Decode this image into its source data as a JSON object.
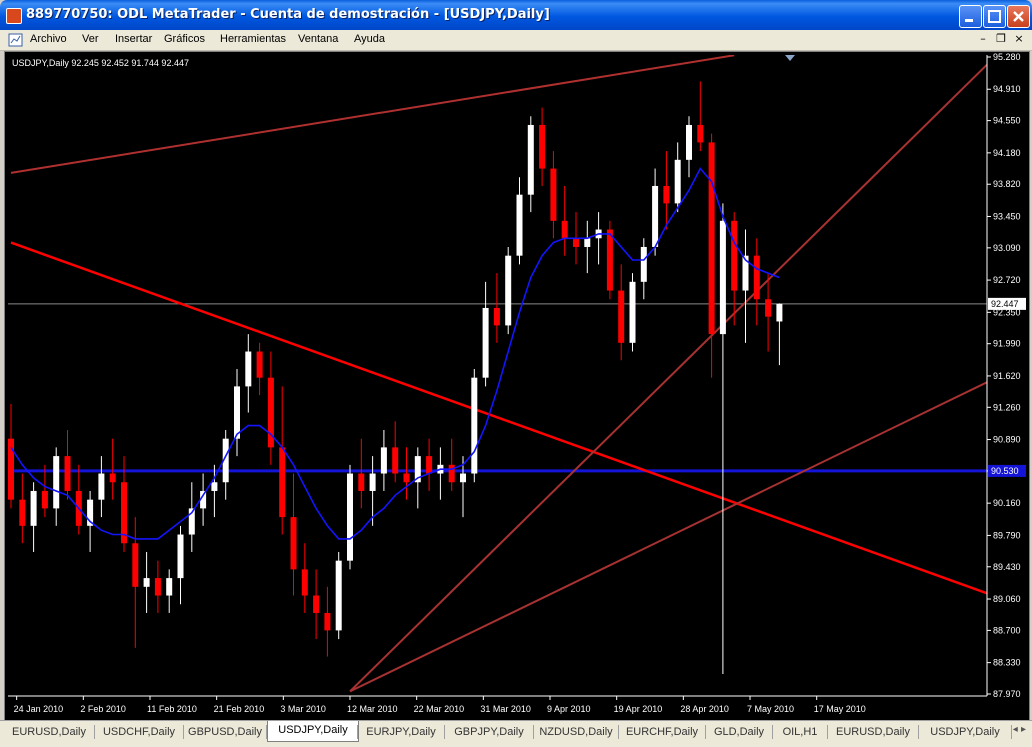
{
  "window": {
    "title": "889770750: ODL MetaTrader - Cuenta de demostración - [USDJPY,Daily]"
  },
  "menu": {
    "items": [
      "Archivo",
      "Ver",
      "Insertar",
      "Gráficos",
      "Herramientas",
      "Ventana",
      "Ayuda"
    ]
  },
  "chart_data": {
    "type": "candlestick",
    "title": "USDJPY,Daily  92.245 92.452 91.744 92.447",
    "last_price_label": "92.447",
    "horizontal_line_label": "90.530",
    "ylim": [
      87.97,
      95.28
    ],
    "y_ticks": [
      "95.280",
      "94.910",
      "94.550",
      "94.180",
      "93.820",
      "93.450",
      "93.090",
      "92.720",
      "92.350",
      "91.990",
      "91.620",
      "91.260",
      "90.890",
      "90.530",
      "90.160",
      "89.790",
      "89.430",
      "89.060",
      "88.700",
      "88.330",
      "87.970"
    ],
    "x_ticks": [
      "24 Jan 2010",
      "2 Feb 2010",
      "11 Feb 2010",
      "21 Feb 2010",
      "3 Mar 2010",
      "12 Mar 2010",
      "22 Mar 2010",
      "31 Mar 2010",
      "9 Apr 2010",
      "19 Apr 2010",
      "28 Apr 2010",
      "7 May 2010",
      "17 May 2010"
    ],
    "candles": [
      [
        90.9,
        91.3,
        90.1,
        90.2
      ],
      [
        90.2,
        90.5,
        89.7,
        89.9
      ],
      [
        89.9,
        90.4,
        89.6,
        90.3
      ],
      [
        90.3,
        90.6,
        90.0,
        90.1
      ],
      [
        90.1,
        90.8,
        89.9,
        90.7
      ],
      [
        90.7,
        91.0,
        90.2,
        90.3
      ],
      [
        90.3,
        90.6,
        89.8,
        89.9
      ],
      [
        89.9,
        90.3,
        89.6,
        90.2
      ],
      [
        90.2,
        90.7,
        90.0,
        90.5
      ],
      [
        90.5,
        90.9,
        90.2,
        90.4
      ],
      [
        90.4,
        90.7,
        89.6,
        89.7
      ],
      [
        89.7,
        90.0,
        88.5,
        89.2
      ],
      [
        89.2,
        89.6,
        88.9,
        89.3
      ],
      [
        89.3,
        89.5,
        88.9,
        89.1
      ],
      [
        89.1,
        89.4,
        88.9,
        89.3
      ],
      [
        89.3,
        89.9,
        89.0,
        89.8
      ],
      [
        89.8,
        90.4,
        89.6,
        90.1
      ],
      [
        90.1,
        90.5,
        89.9,
        90.3
      ],
      [
        90.3,
        90.6,
        90.0,
        90.4
      ],
      [
        90.4,
        91.0,
        90.2,
        90.9
      ],
      [
        90.9,
        91.7,
        90.7,
        91.5
      ],
      [
        91.5,
        92.1,
        91.2,
        91.9
      ],
      [
        91.9,
        92.0,
        91.4,
        91.6
      ],
      [
        91.6,
        91.9,
        90.6,
        90.8
      ],
      [
        90.8,
        91.5,
        89.8,
        90.0
      ],
      [
        90.0,
        90.5,
        89.1,
        89.4
      ],
      [
        89.4,
        89.7,
        88.9,
        89.1
      ],
      [
        89.1,
        89.4,
        88.6,
        88.9
      ],
      [
        88.9,
        89.2,
        88.4,
        88.7
      ],
      [
        88.7,
        89.6,
        88.6,
        89.5
      ],
      [
        89.5,
        90.6,
        89.4,
        90.5
      ],
      [
        90.5,
        90.9,
        90.1,
        90.3
      ],
      [
        90.3,
        90.7,
        89.9,
        90.5
      ],
      [
        90.5,
        91.0,
        90.3,
        90.8
      ],
      [
        90.8,
        91.1,
        90.4,
        90.5
      ],
      [
        90.5,
        90.8,
        90.2,
        90.4
      ],
      [
        90.4,
        90.8,
        90.1,
        90.7
      ],
      [
        90.7,
        90.9,
        90.3,
        90.5
      ],
      [
        90.5,
        90.8,
        90.2,
        90.6
      ],
      [
        90.6,
        90.9,
        90.3,
        90.4
      ],
      [
        90.4,
        90.7,
        90.0,
        90.5
      ],
      [
        90.5,
        91.7,
        90.4,
        91.6
      ],
      [
        91.6,
        92.7,
        91.5,
        92.4
      ],
      [
        92.4,
        92.8,
        92.0,
        92.2
      ],
      [
        92.2,
        93.1,
        92.1,
        93.0
      ],
      [
        93.0,
        93.9,
        92.9,
        93.7
      ],
      [
        93.7,
        94.6,
        93.5,
        94.5
      ],
      [
        94.5,
        94.7,
        93.8,
        94.0
      ],
      [
        94.0,
        94.2,
        93.2,
        93.4
      ],
      [
        93.4,
        93.8,
        93.0,
        93.2
      ],
      [
        93.2,
        93.5,
        92.9,
        93.1
      ],
      [
        93.1,
        93.4,
        92.8,
        93.2
      ],
      [
        93.2,
        93.5,
        92.9,
        93.3
      ],
      [
        93.3,
        93.4,
        92.5,
        92.6
      ],
      [
        92.6,
        92.9,
        91.8,
        92.0
      ],
      [
        92.0,
        92.8,
        91.9,
        92.7
      ],
      [
        92.7,
        93.2,
        92.5,
        93.1
      ],
      [
        93.1,
        94.0,
        93.0,
        93.8
      ],
      [
        93.8,
        94.2,
        93.3,
        93.6
      ],
      [
        93.6,
        94.3,
        93.5,
        94.1
      ],
      [
        94.1,
        94.6,
        93.9,
        94.5
      ],
      [
        94.5,
        95.0,
        94.2,
        94.3
      ],
      [
        94.3,
        94.4,
        91.6,
        92.1
      ],
      [
        92.1,
        93.6,
        88.2,
        93.4
      ],
      [
        93.4,
        93.5,
        92.2,
        92.6
      ],
      [
        92.6,
        93.3,
        92.0,
        93.0
      ],
      [
        93.0,
        93.2,
        92.2,
        92.5
      ],
      [
        92.5,
        92.8,
        91.9,
        92.3
      ],
      [
        92.245,
        92.452,
        91.744,
        92.447
      ]
    ],
    "ma": [
      90.8,
      90.6,
      90.45,
      90.35,
      90.3,
      90.25,
      90.1,
      89.95,
      89.85,
      89.8,
      89.8,
      89.75,
      89.75,
      89.75,
      89.85,
      89.95,
      90.05,
      90.25,
      90.45,
      90.7,
      90.95,
      91.05,
      91.05,
      90.95,
      90.8,
      90.6,
      90.35,
      90.1,
      89.9,
      89.75,
      89.75,
      89.85,
      90.0,
      90.1,
      90.25,
      90.35,
      90.45,
      90.5,
      90.55,
      90.55,
      90.6,
      90.75,
      91.05,
      91.45,
      91.9,
      92.35,
      92.75,
      93.0,
      93.15,
      93.2,
      93.2,
      93.2,
      93.25,
      93.25,
      93.1,
      92.95,
      92.95,
      93.1,
      93.35,
      93.55,
      93.75,
      94.0,
      93.85,
      93.45,
      93.15,
      92.95,
      92.85,
      92.8,
      92.75
    ],
    "lines": [
      {
        "name": "upper-channel",
        "p1": [
          0,
          93.95
        ],
        "p2": [
          64,
          95.3
        ],
        "color": "#b03030"
      },
      {
        "name": "downtrend",
        "p1": [
          0,
          93.15
        ],
        "p2": [
          88,
          89.05
        ],
        "color": "#ff0000"
      },
      {
        "name": "uptrend-steep",
        "p1": [
          30,
          88.0
        ],
        "p2": [
          88,
          95.4
        ],
        "color": "#a83232"
      },
      {
        "name": "uptrend-shallow",
        "p1": [
          30,
          88.0
        ],
        "p2": [
          88,
          91.65
        ],
        "color": "#a83232"
      }
    ]
  },
  "tabs": {
    "items": [
      "EURUSD,Daily",
      "USDCHF,Daily",
      "GBPUSD,Daily",
      "USDJPY,Daily",
      "EURJPY,Daily",
      "GBPJPY,Daily",
      "NZDUSD,Daily",
      "EURCHF,Daily",
      "GLD,Daily",
      "OIL,H1",
      "EURUSD,Daily",
      "USDJPY,Daily"
    ]
  },
  "colors": {
    "bull": "#ffffff",
    "bear": "#ff0000",
    "ma": "#1414ff",
    "hline": "#1414d8",
    "axis_text": "#ffffff"
  }
}
